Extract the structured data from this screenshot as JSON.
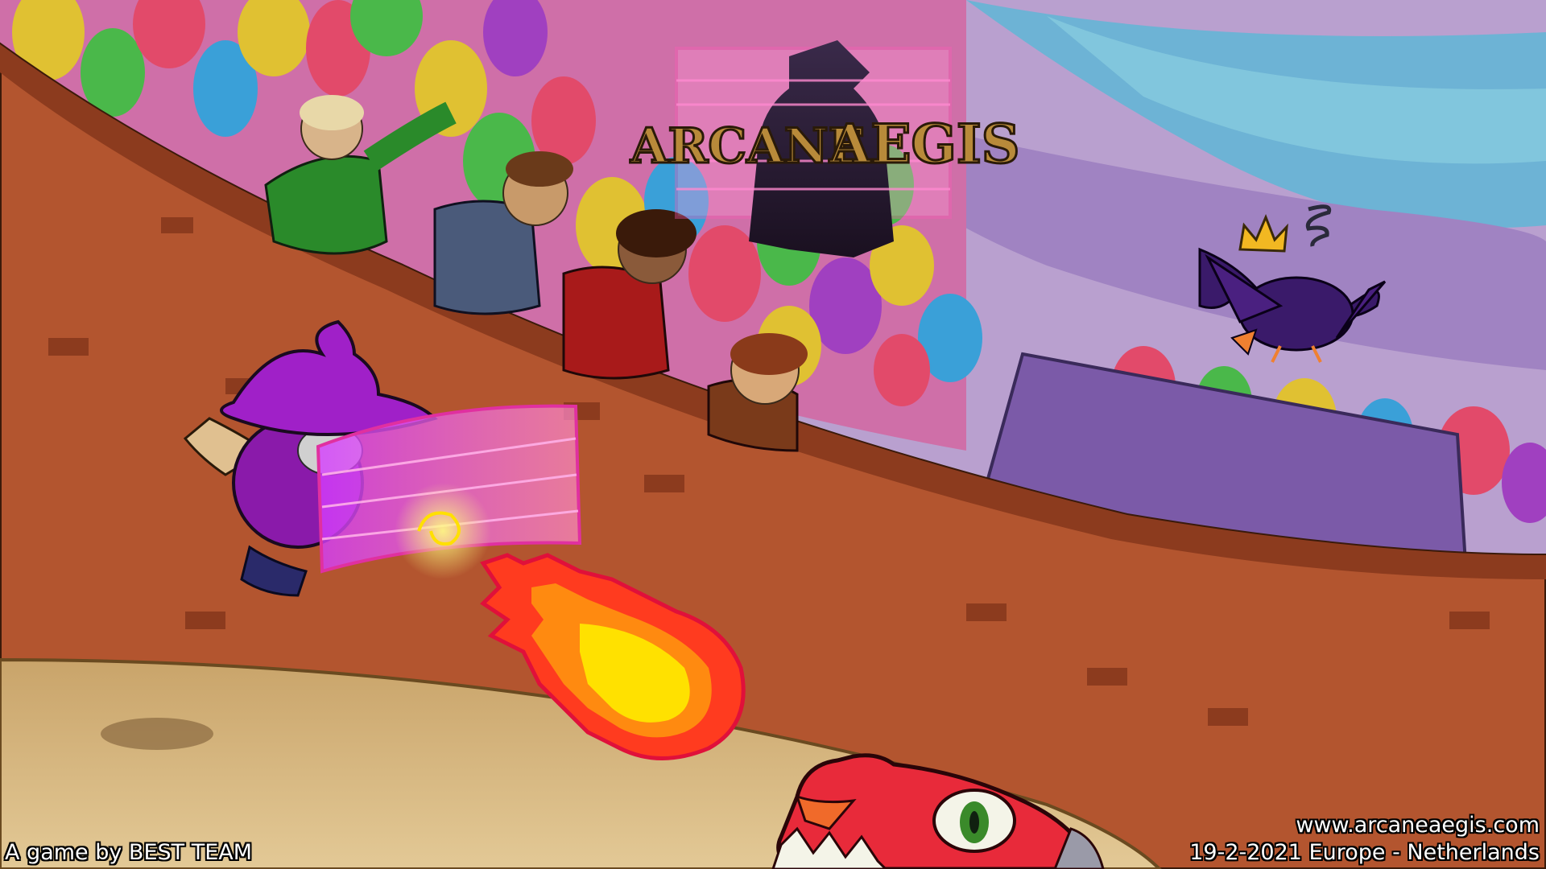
{
  "game": {
    "title_line_1": "ARCANE",
    "title_line_2": "AEGIS"
  },
  "footer": {
    "credit": "A game by BEST TEAM",
    "website": "www.arcaneaegis.com",
    "release": "19-2-2021 Europe - Netherlands"
  },
  "colors": {
    "sky": "#9aa7cf",
    "sky_swirl": "#5fb6d6",
    "stands_purple": "#a88cc4",
    "wall": "#b3552f",
    "wall_shadow": "#8c3b1e",
    "arena_floor": "#d8b782",
    "wizard_hat": "#a020c8",
    "shield": "#e06ad0",
    "fireball_outer": "#ff3b1f",
    "fireball_inner": "#ffe100",
    "crow": "#3a1a6a",
    "crown": "#f2b822",
    "dragon": "#e82a3a",
    "logo_gold": "#b88a3a"
  },
  "icons": [
    "crown-icon",
    "dizzy-icon",
    "fireball",
    "magic-shield"
  ]
}
